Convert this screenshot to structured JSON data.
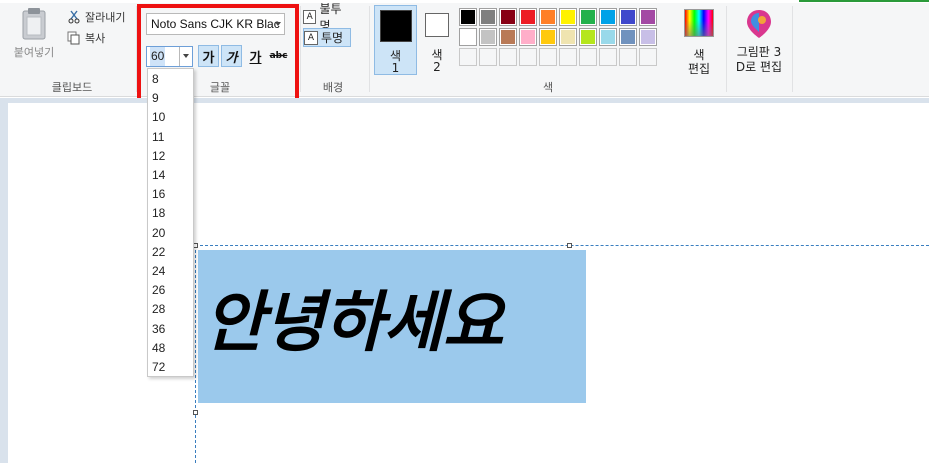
{
  "clipboard": {
    "paste_label": "붙여넣기",
    "cut_label": "잘라내기",
    "copy_label": "복사",
    "group_label": "클립보드"
  },
  "font": {
    "family_value": "Noto Sans CJK KR Blac",
    "size_value": "60",
    "bold_glyph": "가",
    "italic_glyph": "가",
    "underline_glyph": "가",
    "strike_glyph": "abc",
    "group_label": "글꼴",
    "size_options": [
      "8",
      "9",
      "10",
      "11",
      "12",
      "14",
      "16",
      "18",
      "20",
      "22",
      "24",
      "26",
      "28",
      "36",
      "48",
      "72"
    ]
  },
  "background": {
    "opaque_label": "불투명",
    "transparent_label": "투명",
    "group_label": "배경"
  },
  "colors": {
    "color1_line1": "색",
    "color1_line2": "1",
    "color2_line1": "색",
    "color2_line2": "2",
    "edit_line1": "색",
    "edit_line2": "편집",
    "group_label": "색",
    "color1_value": "#000000",
    "color2_value": "#ffffff",
    "palette_row1": [
      "#000000",
      "#7f7f7f",
      "#880015",
      "#ed1c24",
      "#ff7f27",
      "#fff200",
      "#22b14c",
      "#00a2e8",
      "#3f48cc",
      "#a349a4"
    ],
    "palette_row2": [
      "#ffffff",
      "#c3c3c3",
      "#b97a57",
      "#ffaec9",
      "#ffc90e",
      "#efe4b0",
      "#b5e61d",
      "#99d9ea",
      "#7092be",
      "#c8bfe7"
    ]
  },
  "paint3d": {
    "line1": "그림판 3",
    "line2": "D로 편집"
  },
  "canvas": {
    "text": "안녕하세요",
    "text_background": "#9bc9ec"
  },
  "accent": {
    "highlight": "#ee1111",
    "selection": "#cde4f7"
  }
}
